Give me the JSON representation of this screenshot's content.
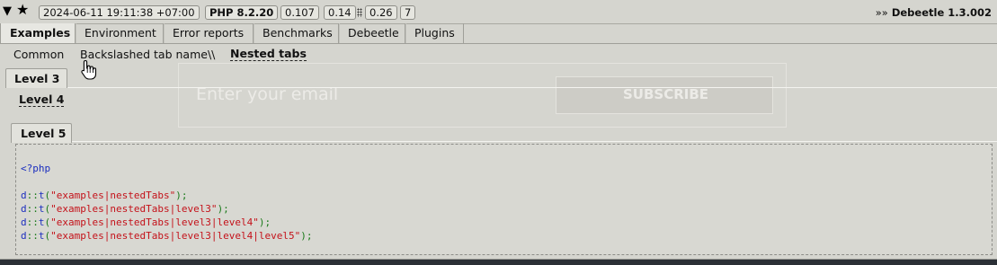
{
  "toolbar": {
    "collapse_icon": "triangle-down-icon",
    "star_icon": "star-icon",
    "datetime": "2024-06-11 19:11:38 +07:00",
    "php_version": "PHP 8.2.20",
    "metric_1": "0.107",
    "metric_2": "0.14",
    "metric_3": "0.26",
    "metric_4": "7",
    "brand_prefix": "»»",
    "brand": "Debeetle 1.3.002"
  },
  "main_tabs": [
    "Examples",
    "Environment",
    "Error reports",
    "Benchmarks",
    "Debeetle",
    "Plugins"
  ],
  "sub_tabs": [
    "Common",
    "Backslashed tab name\\\\",
    "Nested tabs"
  ],
  "levels": {
    "level3": "Level 3",
    "level4": "Level 4",
    "level5": "Level 5"
  },
  "code": {
    "open_tag": "<?php",
    "lines": [
      {
        "fn": "d",
        "op": "::",
        "method": "t",
        "arg": "\"examples|nestedTabs\""
      },
      {
        "fn": "d",
        "op": "::",
        "method": "t",
        "arg": "\"examples|nestedTabs|level3\""
      },
      {
        "fn": "d",
        "op": "::",
        "method": "t",
        "arg": "\"examples|nestedTabs|level3|level4\""
      },
      {
        "fn": "d",
        "op": "::",
        "method": "t",
        "arg": "\"examples|nestedTabs|level3|level4|level5\""
      }
    ]
  },
  "background_page": {
    "email_placeholder": "Enter your email",
    "subscribe_button": "SUBSCRIBE"
  }
}
